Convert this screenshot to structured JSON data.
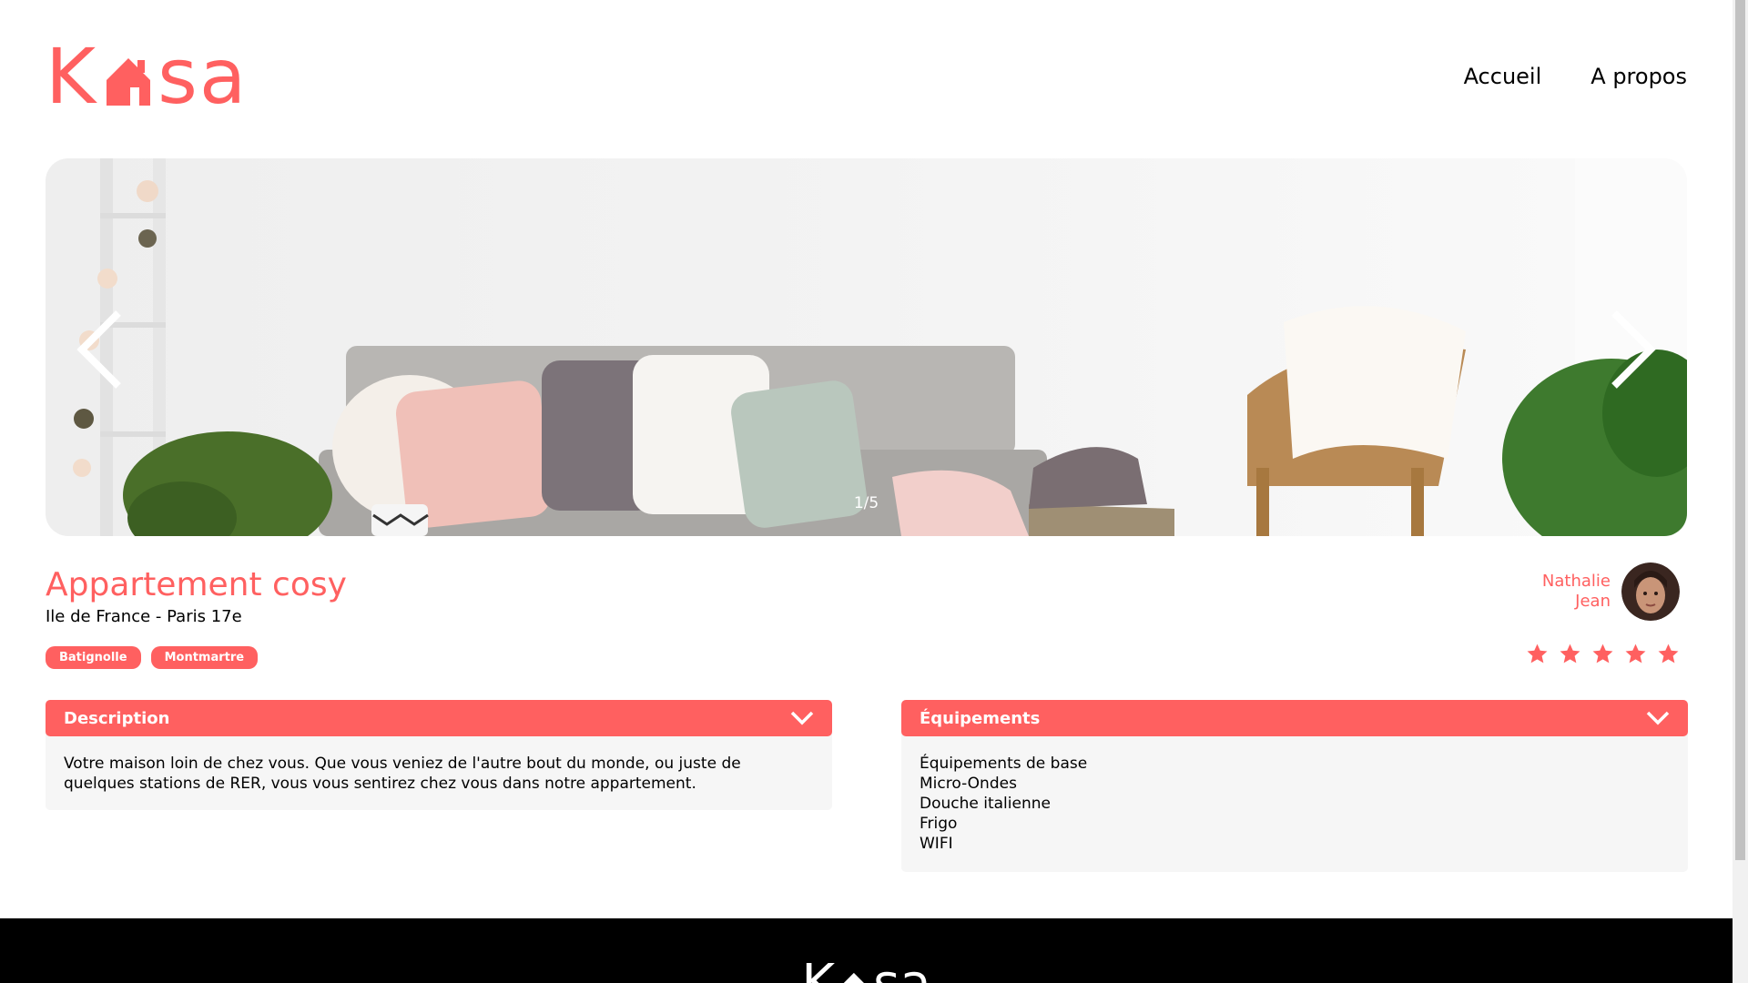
{
  "brand": {
    "logo_letters": [
      "K",
      "s",
      "a"
    ],
    "color": "#FF6060"
  },
  "nav": {
    "home": "Accueil",
    "about": "A propos"
  },
  "carousel": {
    "counter": "1/5"
  },
  "listing": {
    "title": "Appartement cosy",
    "location": "Ile de France - Paris 17e",
    "tags": [
      "Batignolle",
      "Montmartre"
    ],
    "rating": 5,
    "rating_max": 5
  },
  "host": {
    "first_name": "Nathalie",
    "last_name": "Jean"
  },
  "description": {
    "label": "Description",
    "text": "Votre maison loin de chez vous. Que vous veniez de l'autre bout du monde, ou juste de quelques stations de RER, vous vous sentirez chez vous dans notre appartement."
  },
  "equipments": {
    "label": "Équipements",
    "items": [
      "Équipements de base",
      "Micro-Ondes",
      "Douche italienne",
      "Frigo",
      "WIFI"
    ]
  },
  "icons": {
    "logo_house": "house-icon",
    "prev": "chevron-left-icon",
    "next": "chevron-right-icon",
    "collapse": "chevron-down-icon",
    "rating": "star-icon"
  }
}
